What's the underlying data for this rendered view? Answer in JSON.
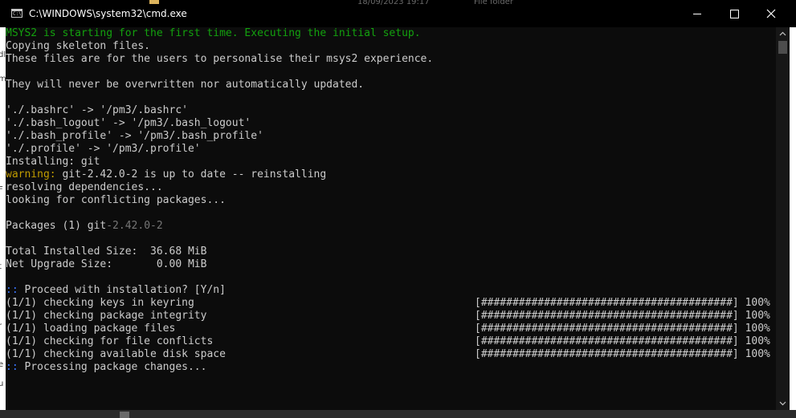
{
  "window": {
    "title": "C:\\WINDOWS\\system32\\cmd.exe",
    "app_icon_glyph": "C:\\"
  },
  "background_peek": {
    "date_text": "18/09/2023 19:17",
    "type_text": "File folder"
  },
  "left_edge_fragments": [
    "dl",
    "m",
    "F",
    "t",
    "r",
    "e",
    "u"
  ],
  "console": {
    "lines": [
      "MSYS2 is starting for the first time. Executing the initial setup.",
      "Copying skeleton files.",
      "These files are for the users to personalise their msys2 experience.",
      "",
      "They will never be overwritten nor automatically updated.",
      "",
      "'./.bashrc' -> '/pm3/.bashrc'",
      "'./.bash_logout' -> '/pm3/.bash_logout'",
      "'./.bash_profile' -> '/pm3/.bash_profile'",
      "'./.profile' -> '/pm3/.profile'",
      "Installing: git",
      "warning:",
      " git-2.42.0-2 is up to date -- reinstalling",
      "resolving dependencies...",
      "looking for conflicting packages...",
      "",
      "Packages (1) ",
      "git",
      "-2.42.0-2",
      "",
      "Total Installed Size:  36.68 MiB",
      "Net Upgrade Size:       0.00 MiB",
      "",
      "::",
      " Proceed with installation? [Y/n]",
      "::",
      " Processing package changes..."
    ],
    "progress": [
      {
        "label": "(1/1) checking keys in keyring",
        "bar": "[########################################]",
        "percent": "100%"
      },
      {
        "label": "(1/1) checking package integrity",
        "bar": "[########################################]",
        "percent": "100%"
      },
      {
        "label": "(1/1) loading package files",
        "bar": "[########################################]",
        "percent": "100%"
      },
      {
        "label": "(1/1) checking for file conflicts",
        "bar": "[########################################]",
        "percent": "100%"
      },
      {
        "label": "(1/1) checking available disk space",
        "bar": "[########################################]",
        "percent": "100%"
      }
    ]
  },
  "colors": {
    "console_bg": "#0c0c0c",
    "text": "#cccccc",
    "green": "#13a10e",
    "yellow": "#c19c00",
    "blue": "#3b78ff",
    "grey": "#767676"
  },
  "icons": {
    "minimize": "minimize-icon",
    "maximize": "maximize-icon",
    "close": "close-icon",
    "scroll_up": "chevron-up-icon",
    "scroll_down": "chevron-down-icon"
  }
}
